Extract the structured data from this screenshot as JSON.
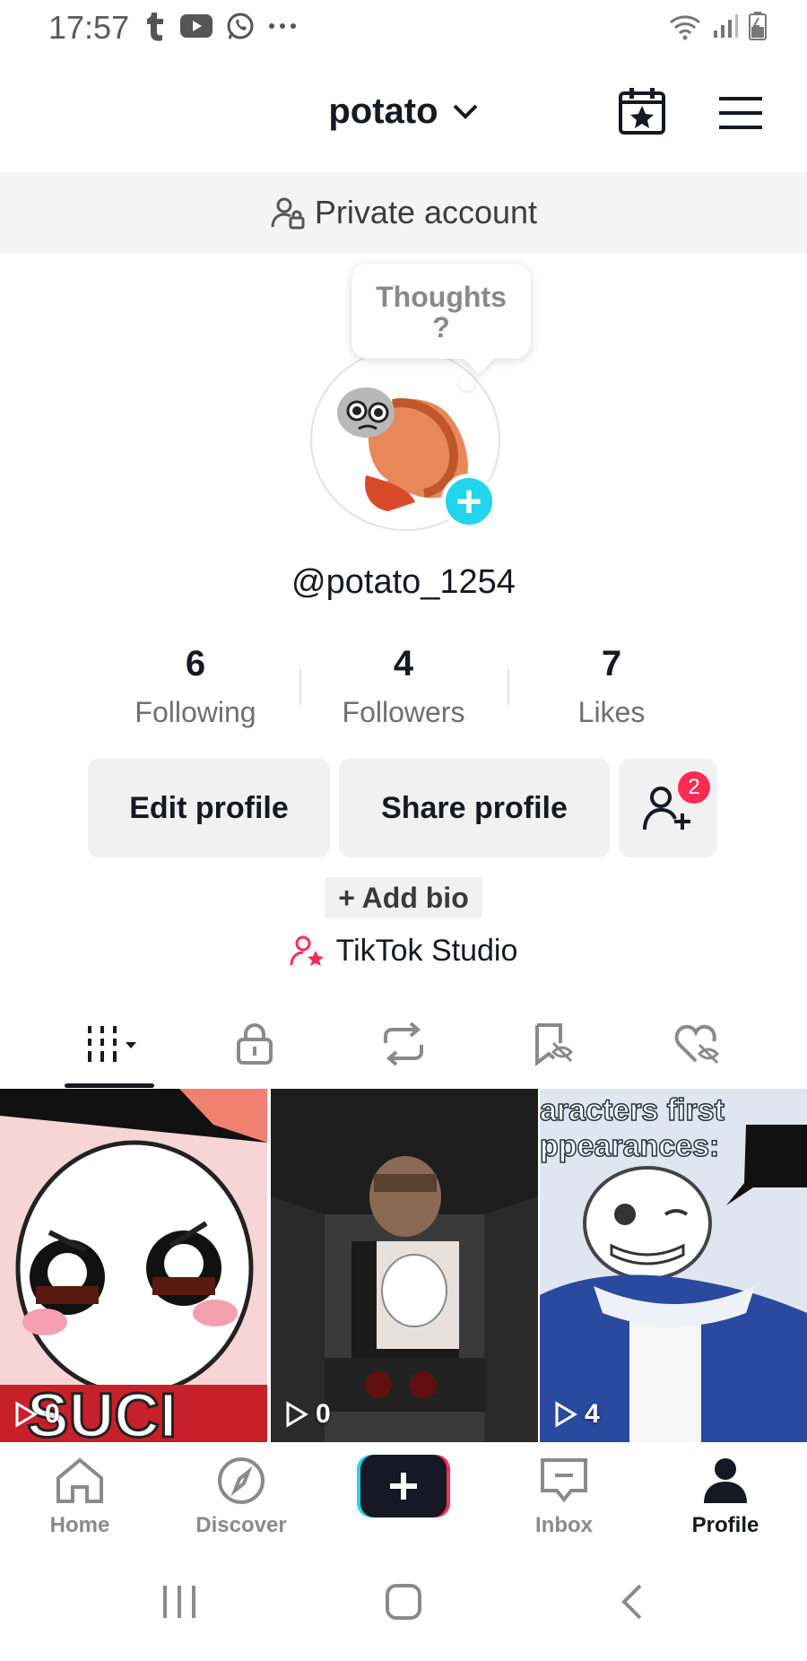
{
  "status_bar": {
    "time": "17:57",
    "app_icons": [
      "tumblr-icon",
      "youtube-icon",
      "whatsapp-icon",
      "more-dots-icon"
    ],
    "system_icons": [
      "wifi-icon",
      "signal-icon",
      "battery-icon"
    ]
  },
  "header": {
    "username": "potato",
    "icons": [
      "calendar-star-icon",
      "hamburger-menu-icon"
    ]
  },
  "private_banner": {
    "label": "Private account"
  },
  "avatar_bubble": {
    "text": "Thoughts\n?"
  },
  "profile": {
    "handle": "@potato_1254",
    "stats": [
      {
        "value": "6",
        "label": "Following"
      },
      {
        "value": "4",
        "label": "Followers"
      },
      {
        "value": "7",
        "label": "Likes"
      }
    ]
  },
  "actions": {
    "edit_profile": "Edit profile",
    "share_profile": "Share profile",
    "friends_badge": "2",
    "add_bio": "+ Add bio",
    "studio": "TikTok Studio"
  },
  "tabs": [
    "videos-grid-icon",
    "lock-icon",
    "repost-icon",
    "saved-icon",
    "liked-icon"
  ],
  "videos": [
    {
      "views": "0",
      "overlay": ""
    },
    {
      "views": "0",
      "overlay": ""
    },
    {
      "views": "4",
      "overlay": "aracters first\nppearances:"
    }
  ],
  "bottom_nav": {
    "items": [
      {
        "label": "Home"
      },
      {
        "label": "Discover"
      },
      {
        "label": ""
      },
      {
        "label": "Inbox"
      },
      {
        "label": "Profile"
      }
    ]
  },
  "colors": {
    "accent_teal": "#20d5ec",
    "accent_pink": "#fe2c55",
    "text_primary": "#161823",
    "button_bg": "#f1f1f2"
  }
}
